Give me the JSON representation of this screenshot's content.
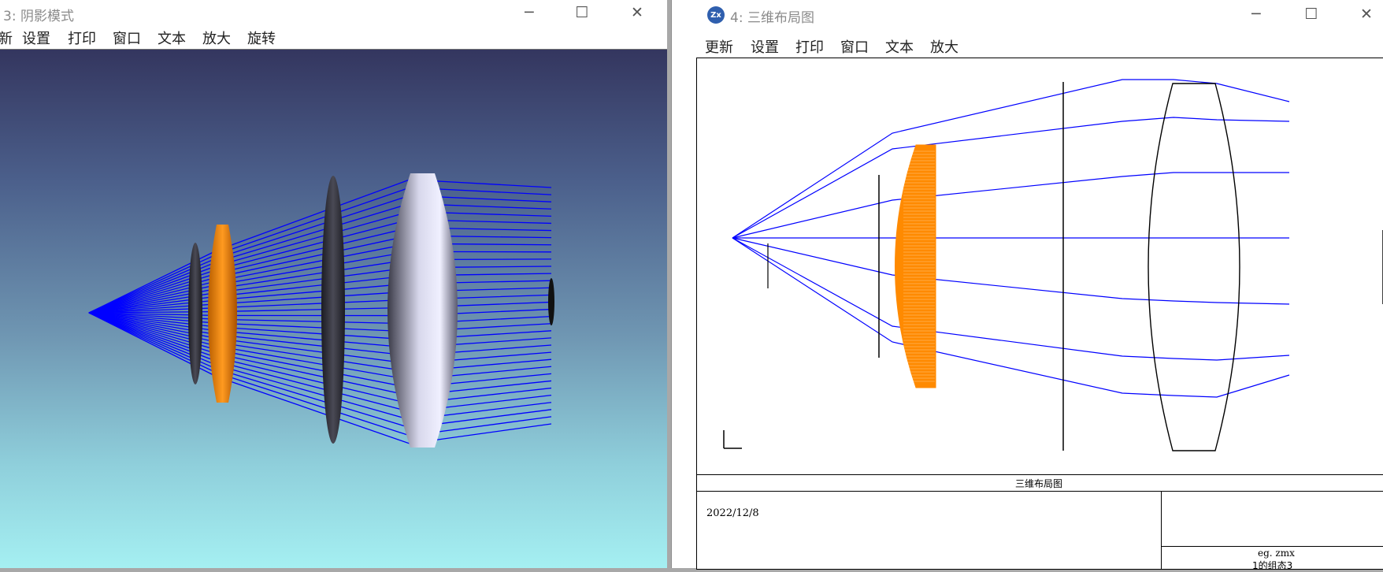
{
  "shaded_window": {
    "title": "3: 阴影模式",
    "menu": [
      "新",
      "设置",
      "打印",
      "窗口",
      "文本",
      "放大",
      "旋转"
    ],
    "colors": {
      "rays": "#0000ff",
      "lens_orange": "#ff8a00",
      "background_top": "#34365f",
      "background_bottom": "#a5f0f2"
    }
  },
  "layout_window": {
    "title": "4: 三维布局图",
    "app_icon": "zemax-icon",
    "app_icon_text": "Zx",
    "menu": [
      "更新",
      "设置",
      "打印",
      "窗口",
      "文本",
      "放大"
    ],
    "plot_title": "三维布局图",
    "date": "2022/12/8",
    "file_name": "eg. zmx",
    "config_label": "1的组态3",
    "colors": {
      "rays": "#0000ff",
      "lens_orange": "#ff8a00"
    }
  },
  "window_controls": {
    "minimize": "─",
    "maximize": "☐",
    "close": "✕"
  }
}
